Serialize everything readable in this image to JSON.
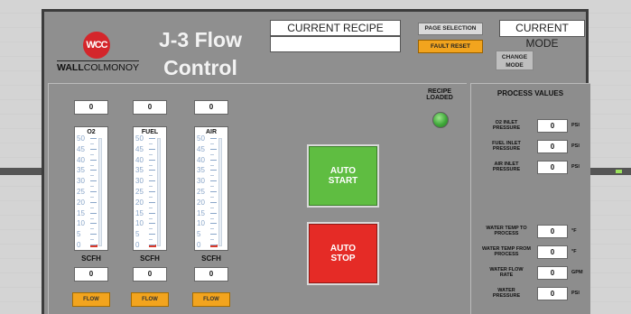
{
  "header": {
    "logo_initials": "WCC",
    "logo_brand_bold": "WALL",
    "logo_brand_rest": "COLMONOY",
    "title_line1": "J-3 Flow",
    "title_line2": "Control",
    "current_recipe_label": "CURRENT RECIPE",
    "current_recipe_value": "",
    "page_selection_label": "PAGE SELECTION",
    "fault_reset_label": "FAULT RESET",
    "current_mode_label": "CURRENT MODE",
    "change_mode_line1": "CHANGE",
    "change_mode_line2": "MODE"
  },
  "gauges": [
    {
      "name": "O2",
      "setpoint": "0",
      "actual": "0",
      "unit": "SCFH",
      "flow_label": "FLOW"
    },
    {
      "name": "FUEL",
      "setpoint": "0",
      "actual": "0",
      "unit": "SCFH",
      "flow_label": "FLOW"
    },
    {
      "name": "AIR",
      "setpoint": "0",
      "actual": "0",
      "unit": "SCFH",
      "flow_label": "FLOW"
    }
  ],
  "gauge_ticks": [
    "50",
    "45",
    "40",
    "35",
    "30",
    "25",
    "20",
    "15",
    "10",
    "5",
    "0"
  ],
  "recipe_loaded": {
    "line1": "RECIPE",
    "line2": "LOADED",
    "led_color": "#3fa83a"
  },
  "controls": {
    "auto_start_line1": "AUTO",
    "auto_start_line2": "START",
    "auto_start_color": "#5fbd41",
    "auto_stop_line1": "AUTO",
    "auto_stop_line2": "STOP",
    "auto_stop_color": "#e52b26"
  },
  "process_values": {
    "title": "PROCESS VALUES",
    "items": [
      {
        "label_line1": "O2 INLET",
        "label_line2": "PRESSURE",
        "value": "0",
        "unit": "PSI"
      },
      {
        "label_line1": "FUEL INLET",
        "label_line2": "PRESSURE",
        "value": "0",
        "unit": "PSI"
      },
      {
        "label_line1": "AIR INLET",
        "label_line2": "PRESSURE",
        "value": "0",
        "unit": "PSI"
      },
      {
        "label_line1": "WATER TEMP TO",
        "label_line2": "PROCESS",
        "value": "0",
        "unit": "°F"
      },
      {
        "label_line1": "WATER TEMP FROM",
        "label_line2": "PROCESS",
        "value": "0",
        "unit": "°F"
      },
      {
        "label_line1": "WATER FLOW",
        "label_line2": "RATE",
        "value": "0",
        "unit": "GPM"
      },
      {
        "label_line1": "WATER",
        "label_line2": "PRESSURE",
        "value": "0",
        "unit": "PSI"
      }
    ]
  },
  "colors": {
    "panel_bg": "#8f8f8f",
    "accent_orange": "#f2a41e"
  }
}
